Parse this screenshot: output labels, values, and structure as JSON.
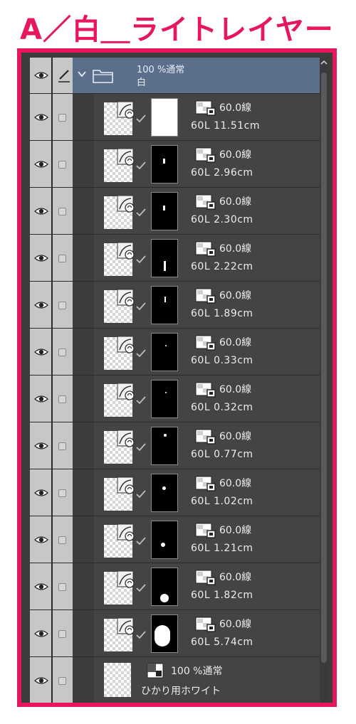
{
  "title": "A／白＿ライトレイヤー",
  "colors": {
    "accent": "#e8175d",
    "folder_row": "#5b6f8c",
    "panel": "#444444",
    "column": "#c7c7c7"
  },
  "icons": {
    "visibility": "eye-icon",
    "edit": "pen-icon",
    "expand": "chevron-down-icon",
    "folder": "folder-icon",
    "layer": "vector-layer-icon",
    "check": "check-icon"
  },
  "folder": {
    "opacity": "100 %通常",
    "name": "白"
  },
  "layers": [
    {
      "opacity": "60.0線",
      "name": "60L 11.51cm",
      "mask": "white"
    },
    {
      "opacity": "60.0線",
      "name": "60L 2.96cm",
      "mask": "line-short"
    },
    {
      "opacity": "60.0線",
      "name": "60L 2.30cm",
      "mask": "line-short"
    },
    {
      "opacity": "60.0線",
      "name": "60L 2.22cm",
      "mask": "line-low"
    },
    {
      "opacity": "60.0線",
      "name": "60L 1.89cm",
      "mask": "line-tiny"
    },
    {
      "opacity": "60.0線",
      "name": "60L 0.33cm",
      "mask": "dot-tiny"
    },
    {
      "opacity": "60.0線",
      "name": "60L 0.32cm",
      "mask": "dot-tiny"
    },
    {
      "opacity": "60.0線",
      "name": "60L 0.77cm",
      "mask": "dot-top"
    },
    {
      "opacity": "60.0線",
      "name": "60L 1.02cm",
      "mask": "dot-mid"
    },
    {
      "opacity": "60.0線",
      "name": "60L 1.21cm",
      "mask": "dot-mid2"
    },
    {
      "opacity": "60.0線",
      "name": "60L 1.82cm",
      "mask": "dot-big"
    },
    {
      "opacity": "60.0線",
      "name": "60L 5.74cm",
      "mask": "blob"
    }
  ],
  "last_layer": {
    "opacity": "100 %通常",
    "name": "ひかり用ホワイト"
  }
}
